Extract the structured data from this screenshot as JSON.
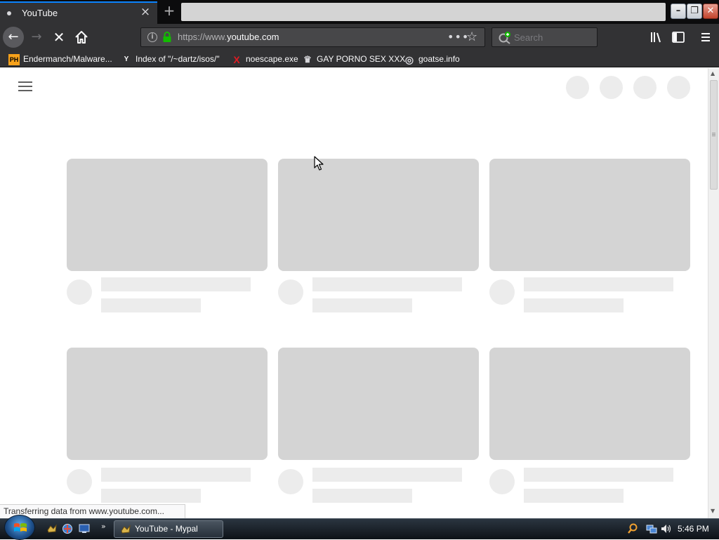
{
  "browser": {
    "tab": {
      "title": "YouTube",
      "close_glyph": "×"
    },
    "newtab_glyph": "+",
    "url": {
      "prefix": "https://www.",
      "domain": "youtube.com"
    },
    "page_actions_glyph": "•••",
    "bookmark_star_glyph": "☆",
    "search_placeholder": "Search",
    "back_glyph": "←",
    "forward_glyph": "→",
    "stop_glyph": "✕",
    "window_buttons": {
      "minimize": "–",
      "maximize": "❐",
      "close": "✕"
    }
  },
  "bookmarks": [
    {
      "label": "Endermanch/Malware...",
      "icon": "PH",
      "icon_bg": "#f7a21b",
      "icon_fg": "#000000"
    },
    {
      "label": "Index of \"/~dartz/isos/\"",
      "icon": "Y",
      "icon_bg": "#323234",
      "icon_fg": "#f9f9fa"
    },
    {
      "label": "noescape.exe",
      "icon": "X",
      "icon_bg": "#323234",
      "icon_fg": "#e01b22"
    },
    {
      "label": "GAY PORNO SEX XXX",
      "icon": "♛",
      "icon_bg": "#323234",
      "icon_fg": "#d7d7db"
    },
    {
      "label": "goatse.info",
      "icon": "◎",
      "icon_bg": "#323234",
      "icon_fg": "#d7d7db"
    }
  ],
  "status_text": "Transferring data from www.youtube.com...",
  "taskbar": {
    "task_label": "YouTube - Mypal",
    "quicklaunch_more": "»",
    "clock": "5:46 PM"
  },
  "colors": {
    "accent": "#0a84ff",
    "skeleton_thumb": "#d4d4d4",
    "skeleton_text": "#ececec",
    "lock_green": "#12bc00"
  }
}
